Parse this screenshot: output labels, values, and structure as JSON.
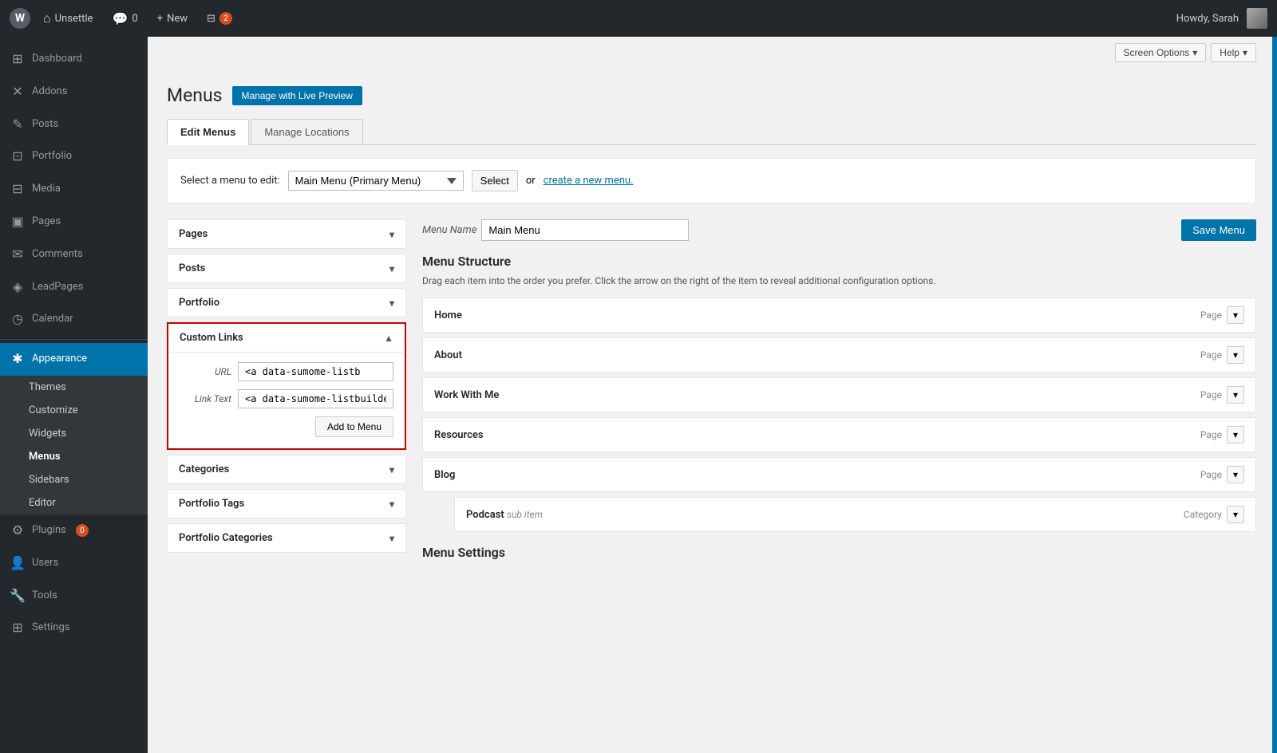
{
  "adminbar": {
    "wp_label": "W",
    "site_name": "Unsettle",
    "comments_count": "0",
    "new_label": "New",
    "plugins_count": "2",
    "howdy": "Howdy, Sarah"
  },
  "top_buttons": {
    "screen_options": "Screen Options",
    "help": "Help"
  },
  "sidebar": {
    "items": [
      {
        "id": "dashboard",
        "icon": "⊞",
        "label": "Dashboard"
      },
      {
        "id": "addons",
        "icon": "✕",
        "label": "Addons"
      },
      {
        "id": "posts",
        "icon": "✎",
        "label": "Posts"
      },
      {
        "id": "portfolio",
        "icon": "⊡",
        "label": "Portfolio"
      },
      {
        "id": "media",
        "icon": "⊟",
        "label": "Media"
      },
      {
        "id": "pages",
        "icon": "▣",
        "label": "Pages"
      },
      {
        "id": "comments",
        "icon": "✉",
        "label": "Comments"
      },
      {
        "id": "leadpages",
        "icon": "◈",
        "label": "LeadPages"
      },
      {
        "id": "calendar",
        "icon": "◷",
        "label": "Calendar"
      },
      {
        "id": "appearance",
        "icon": "✱",
        "label": "Appearance"
      },
      {
        "id": "plugins",
        "icon": "⚙",
        "label": "Plugins",
        "badge": "0"
      },
      {
        "id": "users",
        "icon": "👤",
        "label": "Users"
      },
      {
        "id": "tools",
        "icon": "🔧",
        "label": "Tools"
      },
      {
        "id": "settings",
        "icon": "⊞",
        "label": "Settings"
      }
    ],
    "appearance_submenu": [
      {
        "id": "themes",
        "label": "Themes"
      },
      {
        "id": "customize",
        "label": "Customize"
      },
      {
        "id": "widgets",
        "label": "Widgets"
      },
      {
        "id": "menus",
        "label": "Menus",
        "active": true
      },
      {
        "id": "sidebars",
        "label": "Sidebars"
      },
      {
        "id": "editor",
        "label": "Editor"
      }
    ]
  },
  "page": {
    "title": "Menus",
    "live_preview_btn": "Manage with Live Preview"
  },
  "tabs": [
    {
      "id": "edit-menus",
      "label": "Edit Menus",
      "active": true
    },
    {
      "id": "manage-locations",
      "label": "Manage Locations",
      "active": false
    }
  ],
  "select_menu_bar": {
    "label": "Select a menu to edit:",
    "current_value": "Main Menu (Primary Menu)",
    "select_btn": "Select",
    "or_text": "or",
    "create_link": "create a new menu."
  },
  "left_panel": {
    "sections": [
      {
        "id": "pages",
        "label": "Pages",
        "expanded": false
      },
      {
        "id": "posts",
        "label": "Posts",
        "expanded": false
      },
      {
        "id": "portfolio",
        "label": "Portfolio",
        "expanded": false
      }
    ],
    "custom_links": {
      "label": "Custom Links",
      "expanded": true,
      "url_label": "URL",
      "url_value": "<a data-sumome-listb",
      "url_placeholder": "<a data-sumome-listb",
      "link_text_label": "Link Text",
      "link_text_value": "<a data-sumome-listbuilde",
      "link_text_placeholder": "<a data-sumome-listbuilde",
      "add_btn": "Add to Menu"
    },
    "bottom_sections": [
      {
        "id": "categories",
        "label": "Categories",
        "expanded": false
      },
      {
        "id": "portfolio-tags",
        "label": "Portfolio Tags",
        "expanded": false
      },
      {
        "id": "portfolio-categories",
        "label": "Portfolio Categories",
        "expanded": false
      }
    ]
  },
  "right_panel": {
    "menu_name_label": "Menu Name",
    "menu_name_value": "Main Menu",
    "save_btn": "Save Menu",
    "structure_title": "Menu Structure",
    "structure_help": "Drag each item into the order you prefer. Click the arrow on the right of the item to reveal additional configuration options.",
    "items": [
      {
        "id": "home",
        "name": "Home",
        "type": "Page",
        "sub": false,
        "indent": false
      },
      {
        "id": "about",
        "name": "About",
        "type": "Page",
        "sub": false,
        "indent": false
      },
      {
        "id": "work-with-me",
        "name": "Work With Me",
        "type": "Page",
        "sub": false,
        "indent": false
      },
      {
        "id": "resources",
        "name": "Resources",
        "type": "Page",
        "sub": false,
        "indent": false
      },
      {
        "id": "blog",
        "name": "Blog",
        "type": "Page",
        "sub": false,
        "indent": false
      },
      {
        "id": "podcast",
        "name": "Podcast",
        "type": "Category",
        "sub": true,
        "sub_label": "sub item",
        "indent": true
      }
    ],
    "settings_title": "Menu Settings"
  }
}
